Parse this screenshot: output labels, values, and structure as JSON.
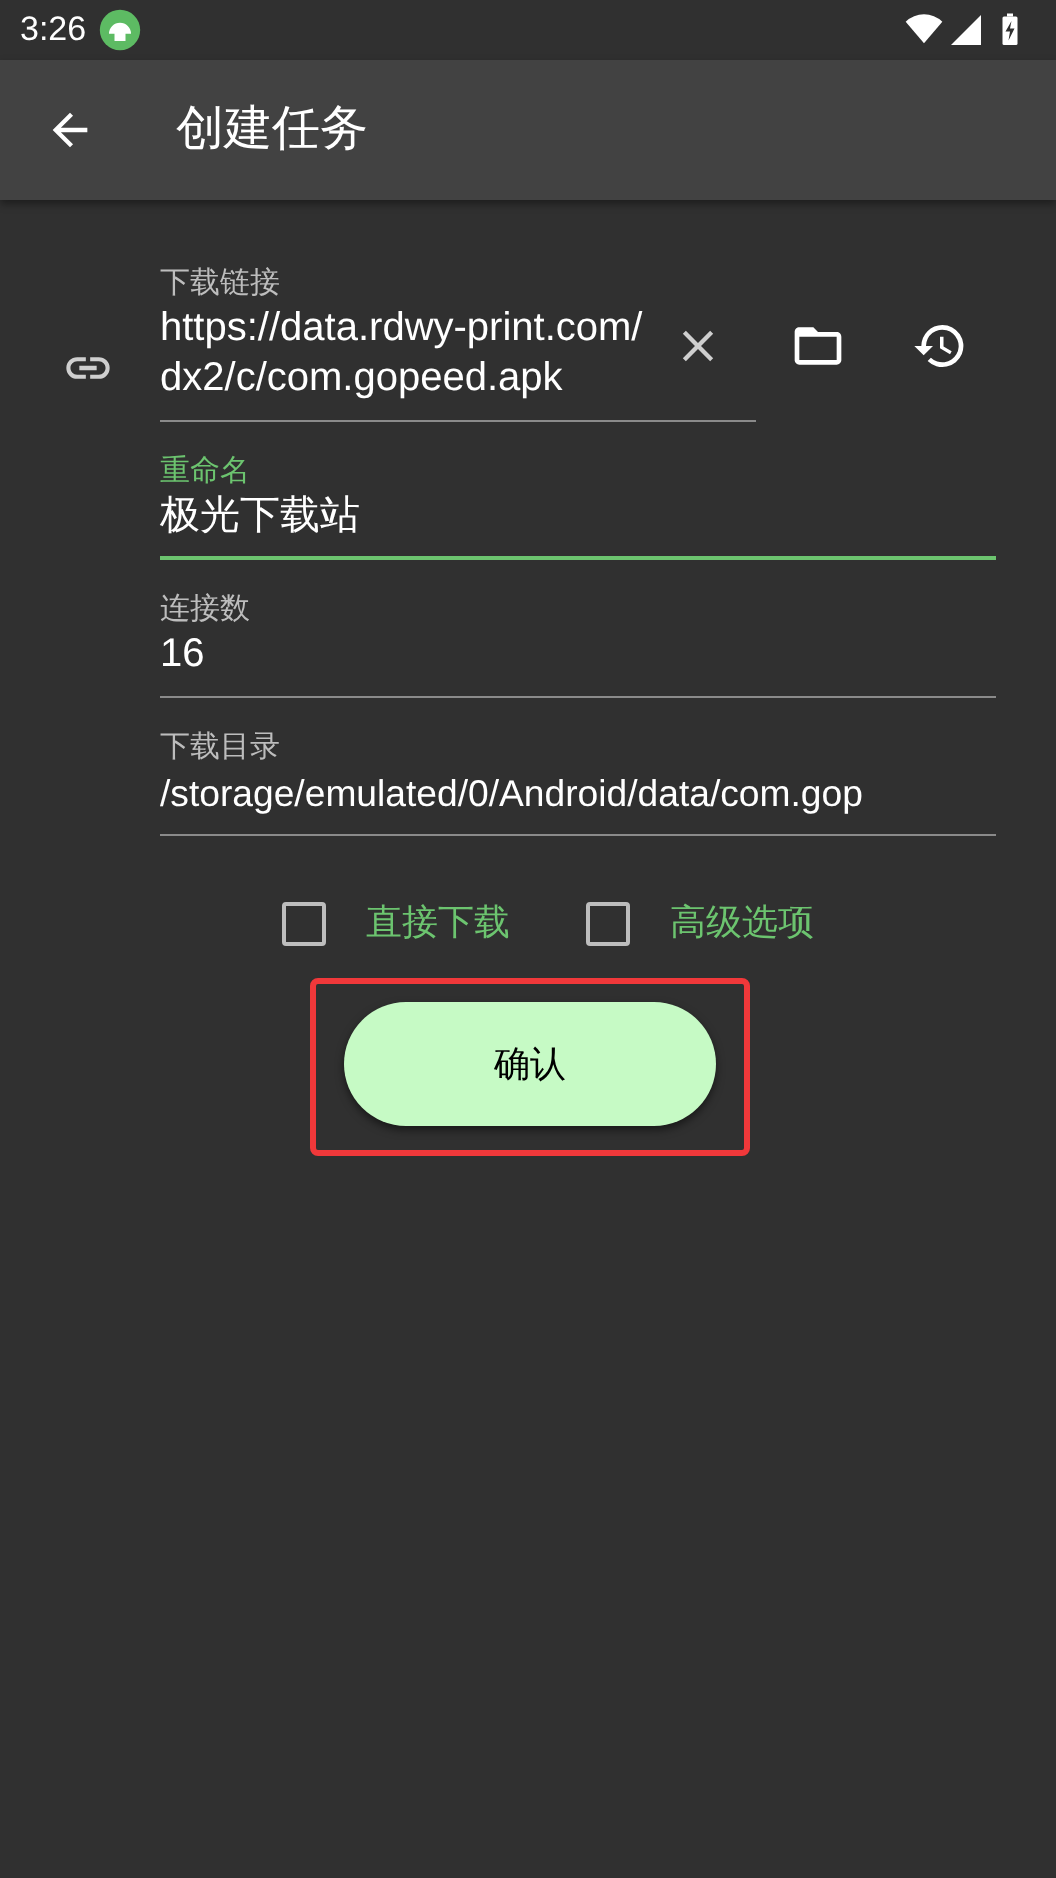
{
  "status_bar": {
    "time": "3:26"
  },
  "app_bar": {
    "title": "创建任务"
  },
  "fields": [
    {
      "kind": "url",
      "label": "下载链接",
      "value": "https://data.rdwy-print.com/dx2/c/com.gopeed.apk",
      "focused": false
    },
    {
      "kind": "text",
      "label": "重命名",
      "value": "极光下载站",
      "focused": true
    },
    {
      "kind": "text",
      "label": "连接数",
      "value": "16",
      "focused": false
    },
    {
      "kind": "text",
      "label": "下载目录",
      "value": "/storage/emulated/0/Android/data/com.gop",
      "focused": false
    }
  ],
  "options": [
    {
      "label": "直接下载",
      "checked": false
    },
    {
      "label": "高级选项",
      "checked": false
    }
  ],
  "confirm_button": {
    "label": "确认",
    "highlighted": true
  }
}
